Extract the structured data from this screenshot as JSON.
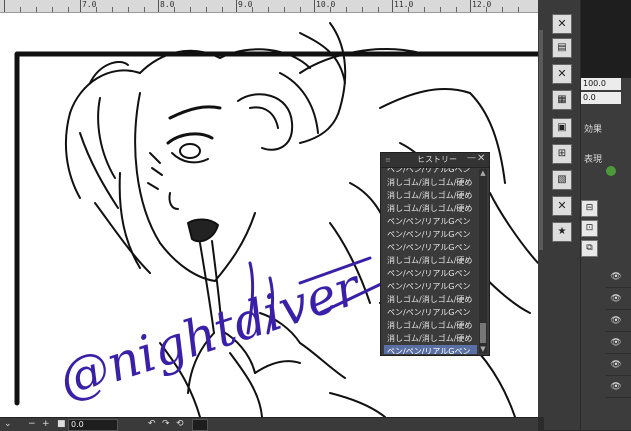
{
  "ruler": {
    "labels": [
      "7.0",
      "8.0",
      "9.0",
      "10.0",
      "11.0",
      "12.0"
    ]
  },
  "history_panel": {
    "title": "ヒストリー",
    "items": [
      "ペン/ペン/リアルGペン",
      "消しゴム/消しゴム/硬め",
      "消しゴム/消しゴム/硬め",
      "消しゴム/消しゴム/硬め",
      "ペン/ペン/リアルGペン",
      "ペン/ペン/リアルGペン",
      "ペン/ペン/リアルGペン",
      "消しゴム/消しゴム/硬め",
      "ペン/ペン/リアルGペン",
      "ペン/ペン/リアルGペン",
      "消しゴム/消しゴム/硬め",
      "ペン/ペン/リアルGペン",
      "消しゴム/消しゴム/硬め",
      "消しゴム/消しゴム/硬め",
      "ペン/ペン/リアルGペン"
    ],
    "selected_index": 14
  },
  "right_panel": {
    "field1": "100.0",
    "field2": "0.0",
    "effect_label": "効果",
    "display_label": "表現"
  },
  "status_bar": {
    "zoom": "0.0"
  },
  "artwork": {
    "watermark": "@nightdiver"
  },
  "colors": {
    "accent": "#5a6fa3",
    "signature": "#3a1fa8"
  }
}
